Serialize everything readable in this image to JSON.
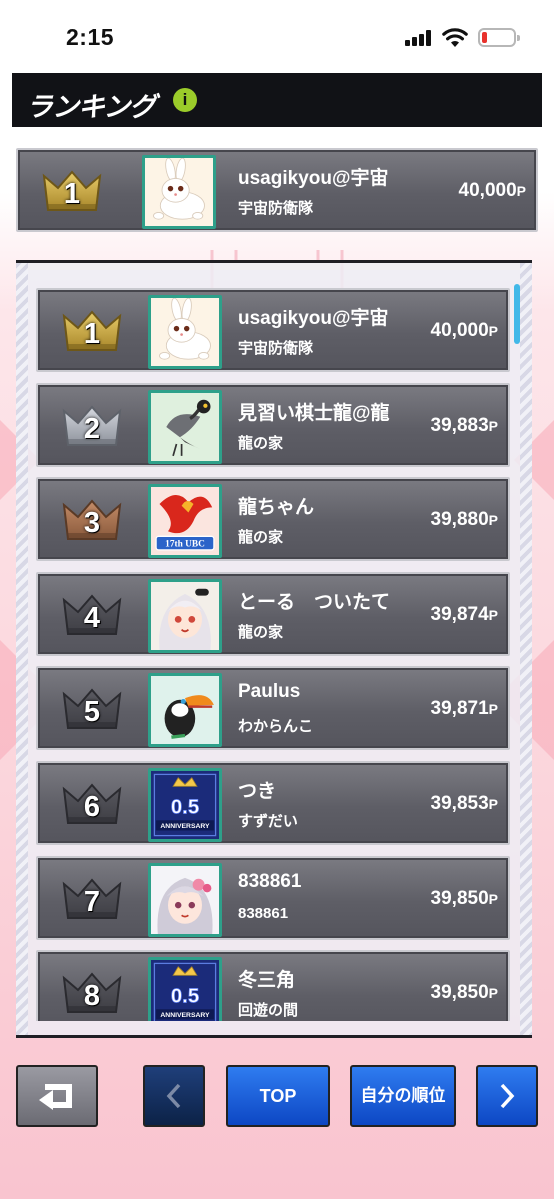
{
  "status_bar": {
    "time": "2:15"
  },
  "header": {
    "title": "ランキング",
    "info_icon": "i"
  },
  "my_rank": {
    "rank": "1",
    "name": "usagikyou@宇宙",
    "team": "宇宙防衛隊",
    "score": "40,000",
    "unit": "P",
    "avatar": "rabbit"
  },
  "ranking": [
    {
      "rank": "1",
      "name": "usagikyou@宇宙",
      "team": "宇宙防衛隊",
      "score": "40,000",
      "unit": "P",
      "medal": "gold",
      "avatar": "rabbit"
    },
    {
      "rank": "2",
      "name": "見習い棋士龍@龍",
      "team": "龍の家",
      "score": "39,883",
      "unit": "P",
      "medal": "silver",
      "avatar": "crane-bird"
    },
    {
      "rank": "3",
      "name": "龍ちゃん",
      "team": "龍の家",
      "score": "39,880",
      "unit": "P",
      "medal": "bronze",
      "avatar": "phoenix-17th-ubc",
      "avatar_text": "17th UBC"
    },
    {
      "rank": "4",
      "name": "とーる　ついたて",
      "team": "龍の家",
      "score": "39,874",
      "unit": "P",
      "medal": "gray",
      "avatar": "anime-girl-white-hair"
    },
    {
      "rank": "5",
      "name": "Paulus",
      "team": "わからんこ",
      "score": "39,871",
      "unit": "P",
      "medal": "gray",
      "avatar": "toucan"
    },
    {
      "rank": "6",
      "name": "つき",
      "team": "すずだい",
      "score": "39,853",
      "unit": "P",
      "medal": "gray",
      "avatar": "anniversary-badge",
      "avatar_text": "0.5",
      "avatar_sub": "ANNIVERSARY"
    },
    {
      "rank": "7",
      "name": "838861",
      "team": "838861",
      "score": "39,850",
      "unit": "P",
      "medal": "gray",
      "avatar": "anime-girl-pink-flower"
    },
    {
      "rank": "8",
      "name": "冬三角",
      "team": "回遊の間",
      "score": "39,850",
      "unit": "P",
      "medal": "gray",
      "avatar": "anniversary-badge",
      "avatar_text": "0.5",
      "avatar_sub": "ANNIVERSARY"
    }
  ],
  "nav": {
    "back_icon": "return-icon",
    "prev_icon": "chevron-left-icon",
    "top_label": "TOP",
    "mine_label": "自分の順位",
    "next_icon": "chevron-right-icon"
  },
  "colors": {
    "gold": "#c9a83a",
    "silver": "#a8acb4",
    "bronze": "#9a6a4c",
    "gray": "#4e4e55",
    "accent_blue": "#1e63e0",
    "info_green": "#9bcc2a"
  }
}
